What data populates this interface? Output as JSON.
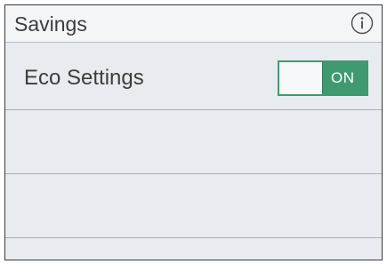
{
  "header": {
    "title": "Savings",
    "info_icon": "info-icon"
  },
  "rows": [
    {
      "label": "Eco Settings",
      "toggle": {
        "state_label": "ON",
        "on": true,
        "accent_color": "#3f9a6f"
      }
    },
    {
      "label": ""
    },
    {
      "label": ""
    },
    {
      "label": ""
    }
  ]
}
